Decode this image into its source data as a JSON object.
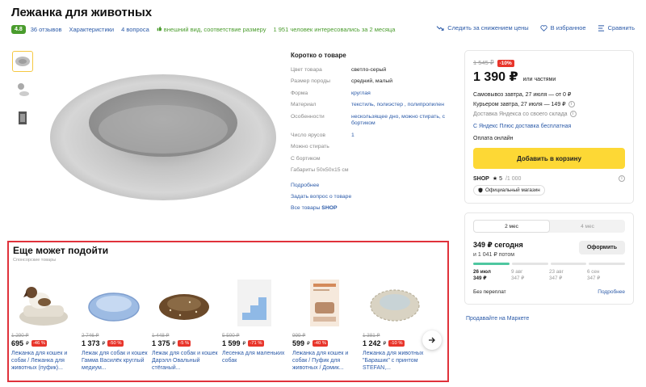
{
  "product": {
    "title": "Лежанка для животных",
    "rating": "4.8",
    "reviews": "36 отзывов",
    "characteristics": "Характеристики",
    "questions": "4 вопроса",
    "badge": "внешний вид, соответствие размеру",
    "interest": "1 951 человек интересовались за 2 месяца"
  },
  "actions": {
    "price_watch": "Следить за снижением цены",
    "favorites": "В избранное",
    "compare": "Сравнить"
  },
  "specs": {
    "title": "Коротко о товаре",
    "rows": [
      {
        "key": "Цвет товара",
        "value": "светло-серый",
        "link": false
      },
      {
        "key": "Размер породы",
        "value": "средний, малый",
        "link": false
      },
      {
        "key": "Форма",
        "value": "круглая",
        "link": true
      },
      {
        "key": "Материал",
        "value": "текстиль, полиэстер , полипропилен",
        "link": true
      },
      {
        "key": "Особенности",
        "value": "нескользящее дно, можно стирать, с бортиком",
        "link": true
      },
      {
        "key": "Число ярусов",
        "value": "1",
        "link": true
      },
      {
        "key": "Можно стирать",
        "value": "",
        "link": false
      },
      {
        "key": "С бортиком",
        "value": "",
        "link": false
      },
      {
        "key": "Габариты 50x50x15 см",
        "value": "",
        "link": false
      }
    ],
    "more": "Подробнее",
    "ask": "Задать вопрос о товаре",
    "all_goods": "Все товары",
    "all_goods_shop": "SHOP"
  },
  "buy": {
    "old_price": "1 545 ₽",
    "discount": "-10%",
    "price": "1 390 ₽",
    "price_suffix": "или частями",
    "pickup": "Самовывоз завтра, 27 июля — от 0 ₽",
    "courier": "Курьером завтра, 27 июля — 149 ₽",
    "warehouse": "Доставка Яндекса со своего склада",
    "plus": "С Яндекс Плюс доставка бесплатная",
    "online": "Оплата онлайн",
    "cart_button": "Добавить в корзину",
    "shop_name": "SHOP",
    "shop_rating": "★ 5",
    "shop_rating_max": "/1 000",
    "official": "Официальный магазин"
  },
  "split": {
    "tab_active": "2 мес",
    "tab_other": "4 мес",
    "today": "349 ₽ сегодня",
    "then": "и 1 041 ₽ потом",
    "button": "Оформить",
    "schedule": [
      {
        "date": "26 июл",
        "amount": "349 ₽"
      },
      {
        "date": "9 авг",
        "amount": "347 ₽"
      },
      {
        "date": "23 авг",
        "amount": "347 ₽"
      },
      {
        "date": "6 сен",
        "amount": "347 ₽"
      }
    ],
    "no_overpay": "Без переплат",
    "more": "Подробнее"
  },
  "sell_link": "Продавайте на Маркете",
  "reco": {
    "title": "Еще может подойти",
    "subtitle": "Спонсорские товары",
    "items": [
      {
        "old": "1 290 ₽",
        "price": "695",
        "disc": "-46 %",
        "name": "Лежанка для кошек и собак / Лежанка для животных (пуфик)..."
      },
      {
        "old": "2 746 ₽",
        "price": "1 373",
        "disc": "-50 %",
        "name": "Лежак для собак и кошек Гамма Василёк круглый медиум..."
      },
      {
        "old": "1 448 ₽",
        "price": "1 375",
        "disc": "-5 %",
        "name": "Лежак для собак и кошек Дарэлл Овальный стёганый..."
      },
      {
        "old": "5 500 ₽",
        "price": "1 599",
        "disc": "-71 %",
        "name": "Лесенка для маленьких собак"
      },
      {
        "old": "999 ₽",
        "price": "599",
        "disc": "-40 %",
        "name": "Лежанка для кошек и собак / Пуфик для животных / Домик..."
      },
      {
        "old": "1 381 ₽",
        "price": "1 242",
        "disc": "-10 %",
        "name": "Лежанка для животных \"Барашик\" с принтом STEFAN,..."
      }
    ],
    "currency": "₽"
  }
}
